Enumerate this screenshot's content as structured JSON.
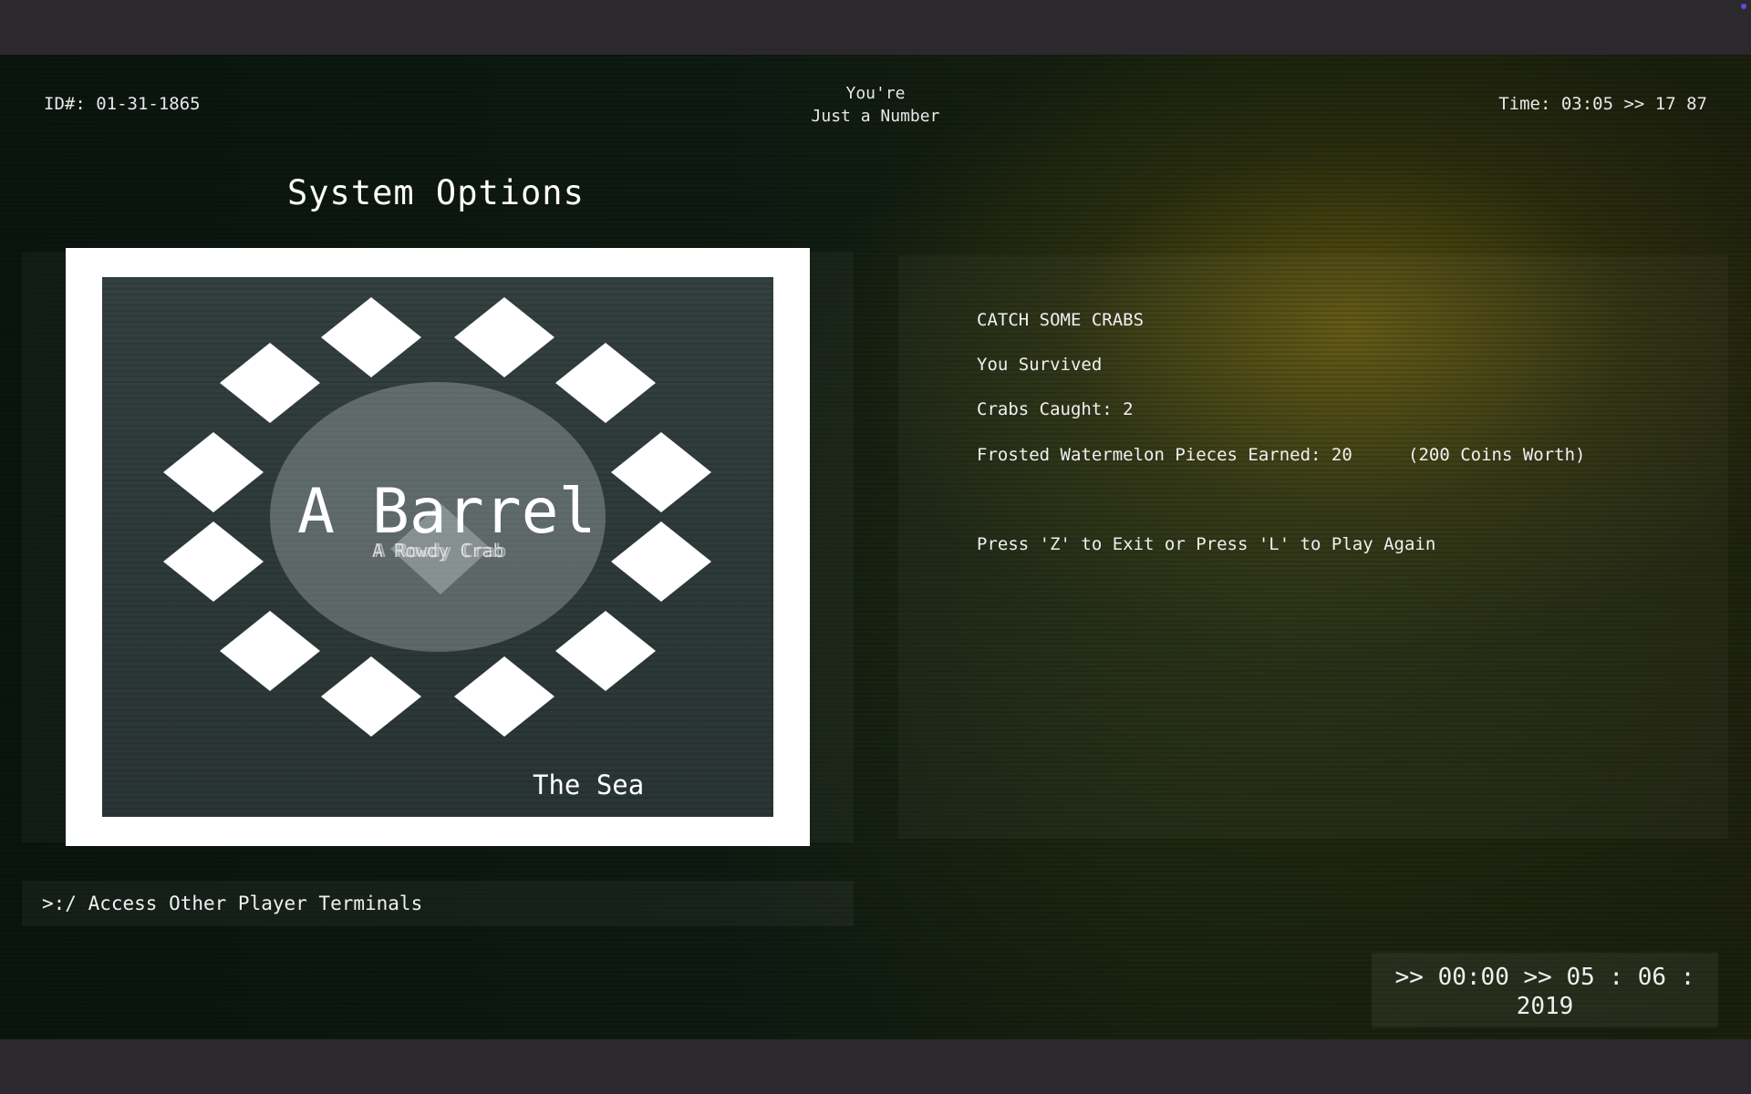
{
  "header": {
    "id_label": "ID#: 01-31-1865",
    "center_line1": "You're",
    "center_line2": "Just a Number",
    "time_label": "Time: 03:05 >> 17 87"
  },
  "page_title": "System Options",
  "artwork": {
    "title": "A Barrel",
    "subtitle": "A Rowdy Crab",
    "location": "The Sea"
  },
  "results": {
    "heading": "CATCH SOME CRABS",
    "status": "You Survived",
    "crabs_caught": "Crabs Caught: 2",
    "watermelon": "Frosted Watermelon Pieces Earned: 20",
    "coins_worth": "(200 Coins Worth)",
    "prompt": "Press 'Z' to Exit or Press 'L' to Play Again"
  },
  "terminal_link": ">:/ Access Other Player Terminals",
  "clock": {
    "line1": ">> 00:00 >> 05 : 06 :",
    "line2": "2019"
  },
  "colors": {
    "background": "#0e1a12",
    "glow": "#967d0f",
    "text": "#ffffff",
    "frame": "#ffffff",
    "art_bg": "#2e3a3a"
  }
}
